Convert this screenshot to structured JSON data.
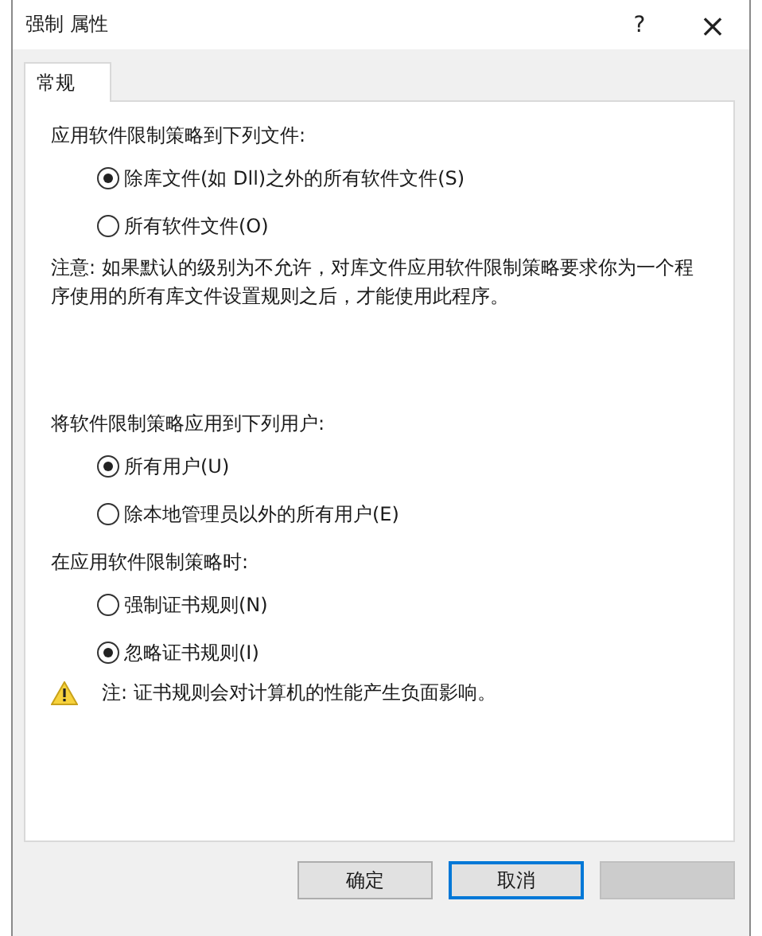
{
  "window": {
    "title": "强制 属性",
    "help": "?",
    "close": "×"
  },
  "tabs": [
    {
      "label": "常规",
      "selected": true
    }
  ],
  "sections": [
    {
      "heading": "应用软件限制策略到下列文件:",
      "options": [
        {
          "label": "除库文件(如 Dll)之外的所有软件文件(S)",
          "selected": true
        },
        {
          "label": "所有软件文件(O)",
          "selected": false
        }
      ],
      "note": "注意: 如果默认的级别为不允许，对库文件应用软件限制策略要求你为一个程序使用的所有库文件设置规则之后，才能使用此程序。"
    },
    {
      "heading": "将软件限制策略应用到下列用户:",
      "options": [
        {
          "label": "所有用户(U)",
          "selected": true
        },
        {
          "label": "除本地管理员以外的所有用户(E)",
          "selected": false
        }
      ]
    },
    {
      "heading": "在应用软件限制策略时:",
      "options": [
        {
          "label": "强制证书规则(N)",
          "selected": false
        },
        {
          "label": "忽略证书规则(I)",
          "selected": true
        }
      ],
      "warning": "注: 证书规则会对计算机的性能产生负面影响。"
    }
  ],
  "buttons": [
    {
      "label": "确定",
      "focused": false,
      "disabled": false
    },
    {
      "label": "取消",
      "focused": true,
      "disabled": false
    },
    {
      "disabled": true,
      "focused": false
    }
  ]
}
